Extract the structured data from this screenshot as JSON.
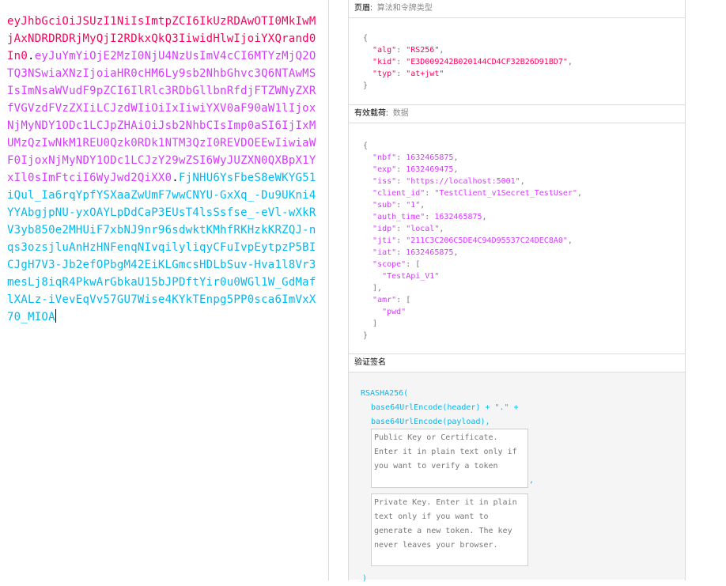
{
  "encoded": {
    "header": "eyJhbGciOiJSUzI1NiIsImtpZCI6IkUzRDAwOTI0MkIwMjAxNDRDRDRjMyQjI2RDkxQkQ3IiwidHlwIjoiYXQrand0In0",
    "payload": "eyJuYmYiOjE2MzI0NjU4NzUsImV4cCI6MTYzMjQ2OTQ3NSwiaXNzIjoiaHR0cHM6Ly9sb2NhbGhvc3Q6NTAwMSIsImNsaWVudF9pZCI6IlRlc3RDbGllbnRfdjFTZWNyZXRfVGVzdFVzZXIiLCJzdWIiOiIxIiwiYXV0aF90aW1lIjoxNjMyNDY1ODc1LCJpZHAiOiJsb2NhbCIsImp0aSI6IjIxMUMzQzIwNkM1REU0Qzk0RDk1NTM3QzI0REVDOEEwIiwiaWF0IjoxNjMyNDY1ODc1LCJzY29wZSI6WyJUZXN0QXBpX1YxIl0sImFtciI6WyJwd2QiXX0",
    "signature": "FjNHU6YsFbeS8eWKYG51iQul_Ia6rqYpfYSXaaZwUmF7wwCNYU-GxXq_-Du9UKni4YYAbgjpNU-yxOAYLpDdCaP3EUsT4lsSsfse_-eVl-wXkRV3yb850e2MHUiF7xbNJ9nr96sdwktKMhfRKHzkKRZQJ-nqs3ozsjluAnHzHNFenqNIvqilyliqyCFuIvpEytpzP5BICJgH7V3-Jb2efOPbgM42EiKLGmcsHDLbSuv-Hva1l8Vr3mesLj8iqR4PkwArGbkaU15bJPDftYir0u0WGl1W_GdMaflXALz-iVevEqVv57GU7Wise4KYkTEnpg5PP0sca6ImVxX70_MIOA",
    "dot": "."
  },
  "header_section": {
    "title": "页眉:",
    "subtitle": "算法和令牌类型",
    "fields": [
      {
        "key": "alg",
        "value": "RS256"
      },
      {
        "key": "kid",
        "value": "E3D009242B020144CD4CF32B26D91BD7"
      },
      {
        "key": "typ",
        "value": "at+jwt"
      }
    ]
  },
  "payload_section": {
    "title": "有效载荷:",
    "subtitle": "数据",
    "fields": [
      {
        "key": "nbf",
        "value": 1632465875
      },
      {
        "key": "exp",
        "value": 1632469475
      },
      {
        "key": "iss",
        "value": "https://localhost:5001"
      },
      {
        "key": "client_id",
        "value": "TestClient_v1Secret_TestUser"
      },
      {
        "key": "sub",
        "value": "1"
      },
      {
        "key": "auth_time",
        "value": 1632465875
      },
      {
        "key": "idp",
        "value": "local"
      },
      {
        "key": "jti",
        "value": "211C3C206C5DE4C94D95537C24DEC8A0"
      },
      {
        "key": "iat",
        "value": 1632465875
      },
      {
        "key": "scope",
        "value": [
          "TestApi_V1"
        ]
      },
      {
        "key": "amr",
        "value": [
          "pwd"
        ]
      }
    ]
  },
  "signature_section": {
    "title": "验证签名",
    "fn_open": "RSASHA256(",
    "line1": "base64UrlEncode(header) + \".\" +",
    "line2": "base64UrlEncode(payload),",
    "public_key_placeholder": "Public Key or Certificate. Enter it in plain text only if you want to verify a token",
    "private_key_placeholder": "Private Key. Enter it in plain text only if you want to generate a new token. The key never leaves your browser.",
    "comma": ",",
    "fn_close": ")"
  },
  "colors": {
    "header": "#fb015b",
    "payload": "#d63aff",
    "signature": "#00b9f1"
  }
}
